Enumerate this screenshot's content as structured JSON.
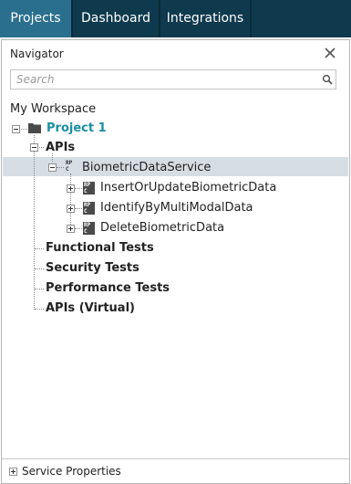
{
  "tabs": [
    {
      "label": "Projects",
      "active": true
    },
    {
      "label": "Dashboard",
      "active": false
    },
    {
      "label": "Integrations",
      "active": false
    }
  ],
  "navigator": {
    "title": "Navigator",
    "search_placeholder": "Search",
    "search_value": ""
  },
  "tree": {
    "workspace": "My Workspace",
    "project": "Project 1",
    "apis_folder": "APIs",
    "service": "BiometricDataService",
    "operations": [
      "InsertOrUpdateBiometricData",
      "IdentifyByMultiModalData",
      "DeleteBiometricData"
    ],
    "folders": [
      "Functional Tests",
      "Security Tests",
      "Performance Tests",
      "APIs (Virtual)"
    ]
  },
  "footer": {
    "label": "Service Properties"
  },
  "colors": {
    "topbar": "#0f3a4e",
    "active_tab": "#2a6f8e",
    "project_text": "#1a8ea3",
    "selection": "#d6dde3"
  },
  "icons": [
    "close-icon",
    "search-icon",
    "folder-icon",
    "rpc-service-icon",
    "rpc-operation-icon",
    "expand-icon",
    "collapse-icon"
  ]
}
